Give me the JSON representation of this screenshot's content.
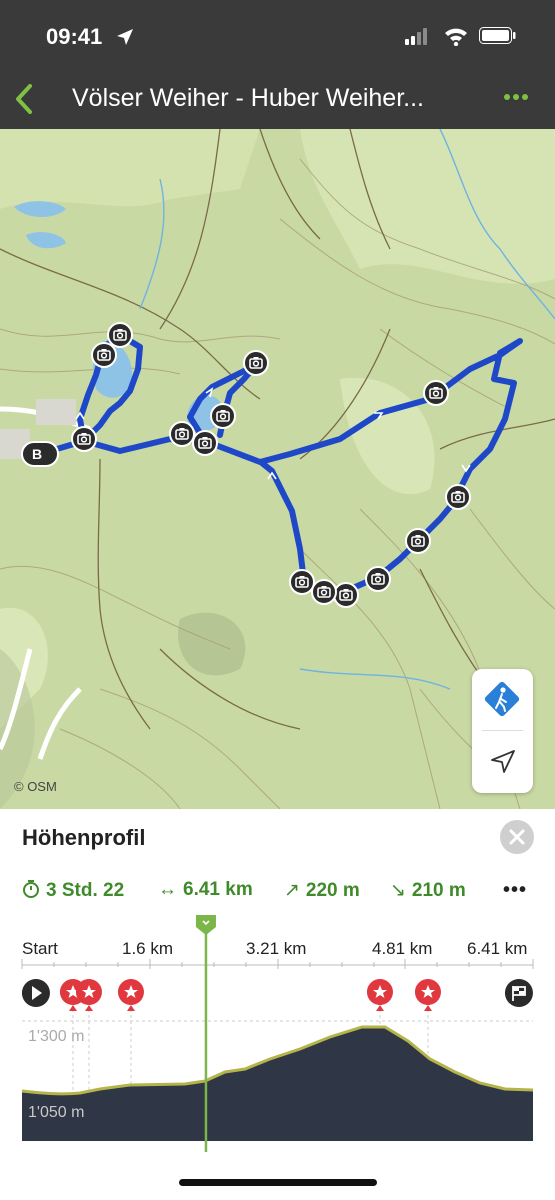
{
  "status_bar": {
    "time": "09:41"
  },
  "nav": {
    "title": "Völser Weiher - Huber Weiher..."
  },
  "map": {
    "attribution": "© OSM",
    "marker_label": "B"
  },
  "profile": {
    "title": "Höhenprofil",
    "stats": {
      "duration": "3 Std. 22",
      "distance": "6.41 km",
      "ascent": "220 m",
      "descent": "210 m"
    },
    "distance_labels": [
      "Start",
      "1.6 km",
      "3.21 km",
      "4.81 km",
      "6.41 km"
    ],
    "elevation_labels": [
      "1'300 m",
      "1'050 m"
    ],
    "current_position_fraction": 0.36
  },
  "colors": {
    "accent": "#3f8a2a",
    "route": "#1f48c8",
    "header": "#3a3a3a",
    "poi_marker": "#e0383e",
    "profile_fill": "#2f3646",
    "map_background": "#c8d8a2"
  },
  "icons": [
    "back-chevron-icon",
    "more-dots-icon",
    "camera-icon",
    "hiking-icon",
    "navigation-arrow-icon",
    "close-icon",
    "stopwatch-icon",
    "horizontal-arrows-icon",
    "ascent-arrow-icon",
    "descent-arrow-icon",
    "play-icon",
    "star-icon",
    "finish-flag-icon"
  ]
}
